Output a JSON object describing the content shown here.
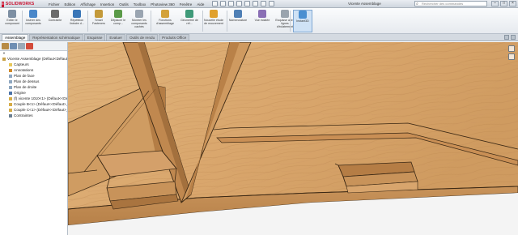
{
  "app": {
    "brand": "SOLIDWORKS",
    "doc_title": "Vicente Assemblage",
    "search_placeholder": "Rechercher des commandes"
  },
  "menu": [
    "Fichier",
    "Edition",
    "Affichage",
    "Insertion",
    "Outils",
    "Toolbox",
    "Photoview 360",
    "Fenêtre",
    "Aide"
  ],
  "ribbon": [
    {
      "label": "Editer le composant",
      "icon": "edit-component-icon",
      "color": "#7d8fa3"
    },
    {
      "label": "Insérer des composants",
      "icon": "insert-components-icon",
      "color": "#4a87c9"
    },
    {
      "label": "Contrainte",
      "icon": "mate-icon",
      "color": "#6b6b6b"
    },
    {
      "label": "Répétition linéaire d...",
      "icon": "linear-pattern-icon",
      "color": "#3a76b7"
    },
    {
      "label": "Smart Fasteners",
      "icon": "smart-fasteners-icon",
      "color": "#c49a3a"
    },
    {
      "label": "Déplacer le comp...",
      "icon": "move-component-icon",
      "color": "#5a9a48"
    },
    {
      "label": "Montrer les composants cachés",
      "icon": "show-hidden-icon",
      "color": "#9aa5b1"
    },
    {
      "label": "Fonctions d'assemblage",
      "icon": "assembly-features-icon",
      "color": "#d3a23a"
    },
    {
      "label": "Géométrie de réf...",
      "icon": "reference-geometry-icon",
      "color": "#3f9a79"
    },
    {
      "label": "Nouvelle étude de mouvement",
      "icon": "motion-study-icon",
      "color": "#e0a12e"
    },
    {
      "label": "Nomenclature",
      "icon": "bom-icon",
      "color": "#4e7fb5"
    },
    {
      "label": "Vue éclatée",
      "icon": "exploded-view-icon",
      "color": "#8a6fb5"
    },
    {
      "label": "Esquisse avec lignes d'éclatement",
      "icon": "explode-line-sketch-icon",
      "color": "#9aa4ae"
    },
    {
      "label": "Instant3D",
      "icon": "instant3d-icon",
      "color": "#4a8fd1"
    }
  ],
  "tabs": [
    "Assemblage",
    "Représentation schématique",
    "Esquisse",
    "Evaluer",
    "Outils de rendu",
    "Produits Office"
  ],
  "active_tab": "Assemblage",
  "tree": [
    {
      "text": "Vicente Assemblage  (Défaut<Défaut_",
      "icon": "assembly-icon",
      "color": "#c9a24a",
      "indent": 0
    },
    {
      "text": "Capteurs",
      "icon": "sensors-icon",
      "color": "#e7c85a",
      "indent": 1
    },
    {
      "text": "Annotations",
      "icon": "annotations-icon",
      "color": "#d08a2a",
      "indent": 1
    },
    {
      "text": "Plan de face",
      "icon": "plane-icon",
      "color": "#8fa7c0",
      "indent": 1
    },
    {
      "text": "Plan de dessus",
      "icon": "plane-icon",
      "color": "#8fa7c0",
      "indent": 1
    },
    {
      "text": "Plan de droite",
      "icon": "plane-icon",
      "color": "#8fa7c0",
      "indent": 1
    },
    {
      "text": "Origine",
      "icon": "origin-icon",
      "color": "#4b73a8",
      "indent": 1
    },
    {
      "text": "(f) vicente 1010<1> (Défaut<<Défa",
      "icon": "part-icon",
      "color": "#d6ad48",
      "indent": 1
    },
    {
      "text": "Couple B<1> (Défaut<<Défaut>_Eta",
      "icon": "part-icon",
      "color": "#d6ad48",
      "indent": 1
    },
    {
      "text": "Couple C<1> (Défaut<<Défaut>_Eta",
      "icon": "part-icon",
      "color": "#d6ad48",
      "indent": 1
    },
    {
      "text": "Contraintes",
      "icon": "mates-icon",
      "color": "#6b7f92",
      "indent": 1
    }
  ],
  "colors": {
    "wood_light": "#d9a66c",
    "wood_mid": "#c8935a",
    "wood_dark": "#9e6b37",
    "edge": "#3b2814",
    "accent": "#c8102e"
  }
}
